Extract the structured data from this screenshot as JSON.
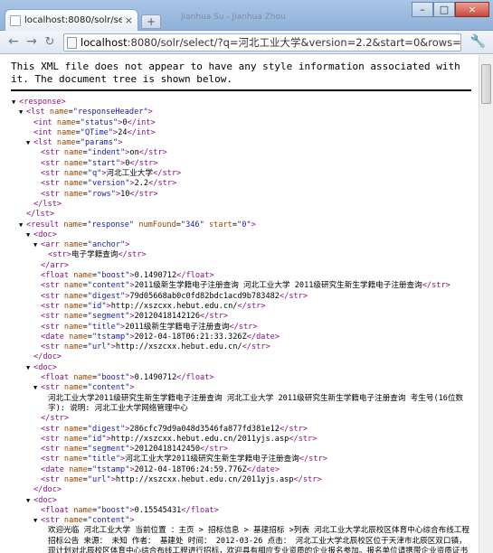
{
  "browser": {
    "tab_title": "localhost:8080/solr/selec",
    "tab_close": "×",
    "new_tab": "+",
    "ghost_title": "Jianhua Su - Jianhua Zhou",
    "url_host": "localhost",
    "url_rest": ":8080/solr/select/?q=河北工业大学&version=2.2&start=0&rows=10&i",
    "window_buttons": [
      "–",
      "□",
      "×"
    ]
  },
  "notice": "This XML file does not appear to have any style information associated with it. The document tree is shown below.",
  "xml": {
    "response": "response",
    "lst": "lst",
    "int": "int",
    "str": "str",
    "arr": "arr",
    "float": "float",
    "date": "date",
    "result": "result",
    "doc": "doc",
    "name": "name",
    "header_name": "responseHeader",
    "status": {
      "name": "status",
      "value": "0"
    },
    "qtime": {
      "name": "QTime",
      "value": "24"
    },
    "params_name": "params",
    "params": [
      {
        "name": "indent",
        "value": "on"
      },
      {
        "name": "start",
        "value": "0"
      },
      {
        "name": "q",
        "value": "河北工业大学"
      },
      {
        "name": "version",
        "value": "2.2"
      },
      {
        "name": "rows",
        "value": "10"
      }
    ],
    "result_name": "response",
    "numfound_attr": "numFound",
    "numfound": "346",
    "start_attr": "start",
    "start": "0",
    "doc1": {
      "anchor_name": "anchor",
      "anchor": "电子学籍查询",
      "boost": "0.1490712",
      "content": "2011级新生学籍电子注册查询 河北工业大学 2011级研究生新生学籍电子注册查询",
      "digest": "79d05668ab0c0fd82bdc1acd9b783482",
      "id": "http://xszcxx.hebut.edu.cn/",
      "segment": "20120418142126",
      "title": "2011级新生学籍电子注册查询",
      "tstamp": "2012-04-18T06:21:33.326Z",
      "url": "http://xszcxx.hebut.edu.cn/"
    },
    "doc2": {
      "boost": "0.1490712",
      "content": "河北工业大学2011级研究生新生学籍电子注册查询 河北工业大学 2011级研究生新生学籍电子注册查询 考生号(16位数字): 说明: 河北工业大学网络管理中心",
      "digest": "286cfc79d9a048d3546fa877fd381e12",
      "id": "http://xszcxx.hebut.edu.cn/2011yjs.asp",
      "segment": "20120418142450",
      "title": "河北工业大学2011级研究生新生学籍电子注册查询",
      "tstamp": "2012-04-18T06:24:59.776Z",
      "url": "http://xszcxx.hebut.edu.cn/2011yjs.asp"
    },
    "doc3": {
      "boost": "0.15545431",
      "content": "欢迎光临 河北工业大学 当前位置 ：主页 > 招标信息 > 基建招标 >列表 河北工业大学北辰校区体育中心综合布线工程招标公告 来源： 未知 作者： 基建处 时间： 2012-03-26 点击： 河北工业大学北辰校区位于天津市北辰区双口镇，现计划对北辰校区体育中心综合布线工程进行招标，欢迎具有相应专业资质的企业报名参加。报名单位请携带企业资质证书复印件（需加盖单位公章），法人代表或"
    },
    "field_names": {
      "boost": "boost",
      "content": "content",
      "digest": "digest",
      "id": "id",
      "segment": "segment",
      "title": "title",
      "tstamp": "tstamp",
      "url": "url"
    }
  }
}
